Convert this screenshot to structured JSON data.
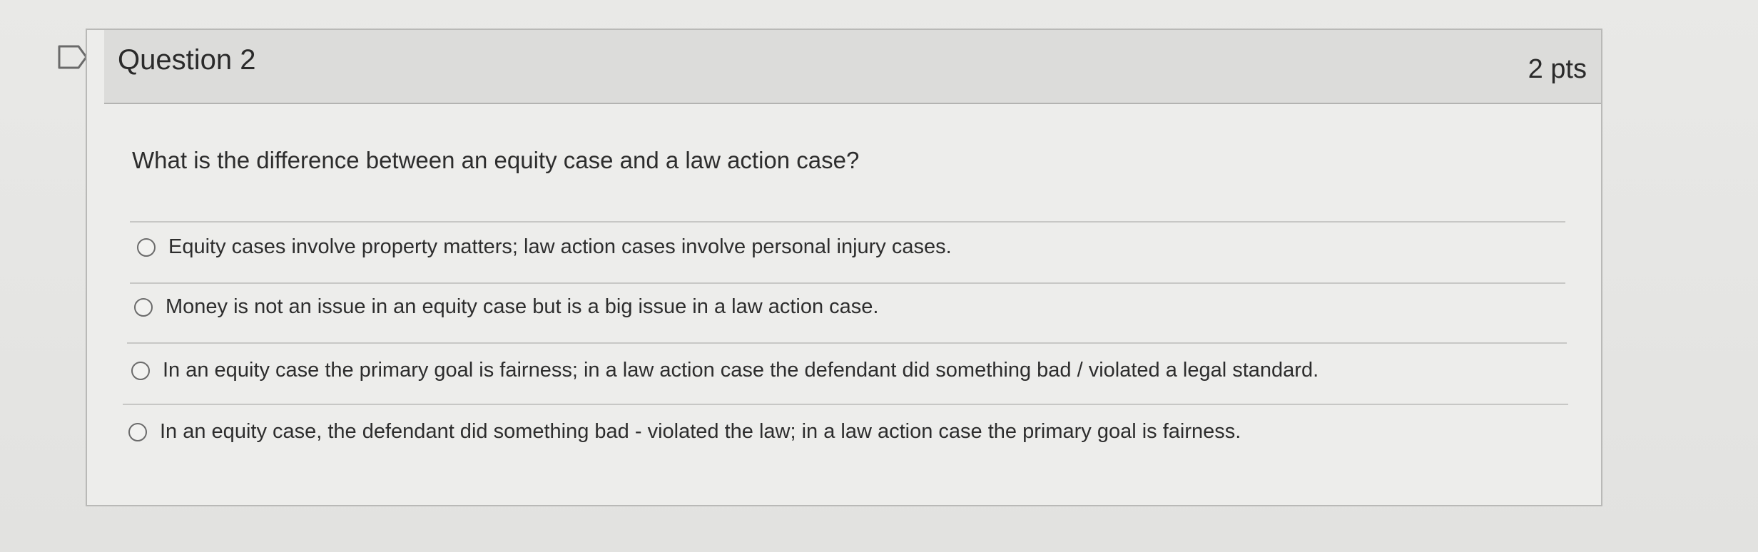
{
  "question": {
    "title": "Question 2",
    "points": "2 pts",
    "text": "What is the difference between an equity case and a law action case?",
    "flag_icon": "bookmark-flag-icon"
  },
  "answers": [
    {
      "label": "Equity cases involve property matters; law action cases involve personal injury cases."
    },
    {
      "label": "Money is not an issue in an equity case but is a big issue in a law action case."
    },
    {
      "label": "In an equity case the primary goal is fairness; in a law action case the defendant did something bad / violated a legal standard."
    },
    {
      "label": "In an equity case, the defendant did something bad - violated the law; in a law action case the primary goal is fairness."
    }
  ]
}
